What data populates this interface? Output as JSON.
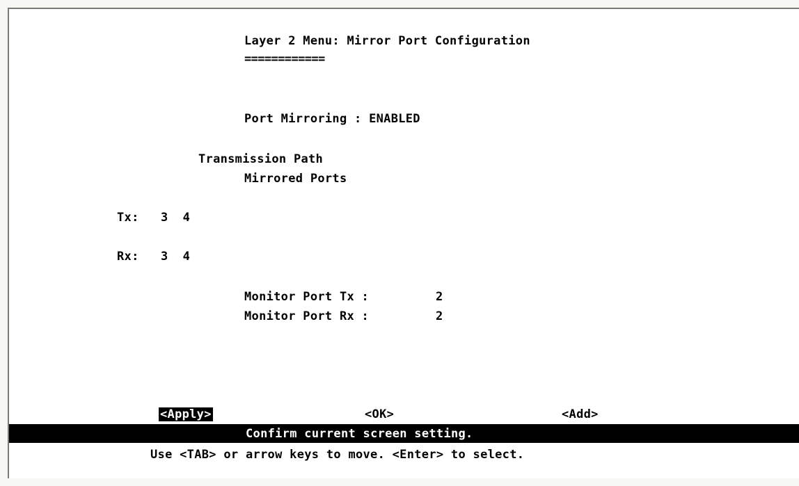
{
  "screen": {
    "title": "Layer 2 Menu: Mirror Port Configuration",
    "title_underline": "============"
  },
  "config": {
    "port_mirroring_label": "Port Mirroring : ENABLED",
    "transmission_path_label": "Transmission Path",
    "mirrored_ports_label": "Mirrored Ports",
    "tx_label": "Tx:",
    "tx_ports": "3  4",
    "rx_label": "Rx:",
    "rx_ports": "3  4",
    "monitor_port_tx_label": "Monitor Port Tx :",
    "monitor_port_tx_value": "2",
    "monitor_port_rx_label": "Monitor Port Rx :",
    "monitor_port_rx_value": "2"
  },
  "actions": {
    "apply_label": "<Apply>",
    "ok_label": "<OK>",
    "add_label": "<Add>",
    "selected": "apply"
  },
  "status": {
    "message": "Confirm current screen setting.",
    "help": "Use <TAB> or arrow keys to move. <Enter> to select."
  },
  "colors": {
    "background": "#ffffff",
    "text": "#000000",
    "status_bar": "#000000",
    "status_text": "#ffffff"
  }
}
